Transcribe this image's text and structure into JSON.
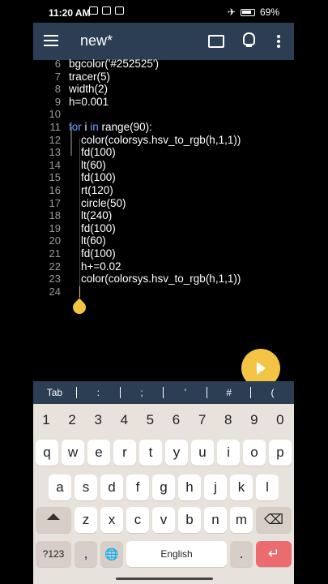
{
  "status": {
    "time": "11:20 AM",
    "battery": "69%"
  },
  "appbar": {
    "title": "new*"
  },
  "editor": {
    "line_numbers": [
      "6",
      "7",
      "8",
      "9",
      "10",
      "11",
      "12",
      "13",
      "14",
      "15",
      "16",
      "17",
      "18",
      "19",
      "20",
      "21",
      "22",
      "23",
      "24"
    ],
    "lines": [
      "bgcolor('#252525')",
      "tracer(5)",
      "width(2)",
      "h=0.001",
      "",
      "for i in range(90):",
      "    color(colorsys.hsv_to_rgb(h,1,1))",
      "    fd(100)",
      "    lt(60)",
      "    fd(100)",
      "    rt(120)",
      "    circle(50)",
      "    lt(240)",
      "    fd(100)",
      "    lt(60)",
      "    fd(100)",
      "    h+=0.02",
      "    color(colorsys.hsv_to_rgb(h,1,1))",
      "    "
    ]
  },
  "symbols": [
    "Tab",
    ":",
    ";",
    "'",
    "#",
    "("
  ],
  "keyboard": {
    "numbers": [
      "1",
      "2",
      "3",
      "4",
      "5",
      "6",
      "7",
      "8",
      "9",
      "0"
    ],
    "row1": [
      "q",
      "w",
      "e",
      "r",
      "t",
      "y",
      "u",
      "i",
      "o",
      "p"
    ],
    "row2": [
      "a",
      "s",
      "d",
      "f",
      "g",
      "h",
      "j",
      "k",
      "l"
    ],
    "row3": [
      "z",
      "x",
      "c",
      "v",
      "b",
      "n",
      "m"
    ],
    "mode_key": "?123",
    "comma": ",",
    "space": "English",
    "period": "."
  },
  "colors": {
    "appbar": "#2b3e53",
    "accent": "#f3c443",
    "enter": "#ec6b6f",
    "keyword": "#6d9eff"
  }
}
